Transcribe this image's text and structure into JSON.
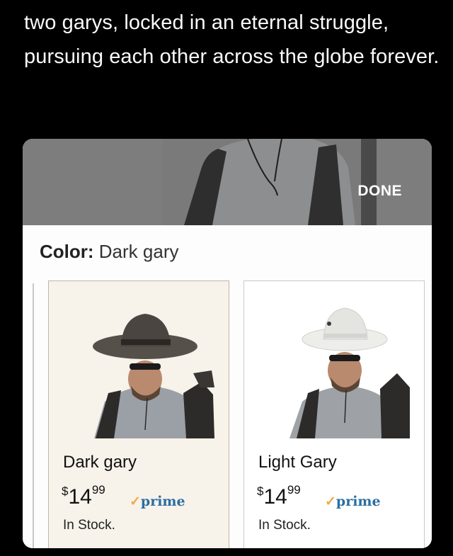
{
  "caption": "two garys, locked in an eternal struggle, pursuing each other across the globe forever.",
  "sheet": {
    "done_label": "DONE",
    "color_label": "Color:",
    "color_value": "Dark gary"
  },
  "variants": [
    {
      "name": "Dark gary",
      "price_currency": "$",
      "price_dollars": "14",
      "price_cents": "99",
      "prime_check": "✓",
      "prime_label": "prime",
      "stock": "In Stock.",
      "selected": true,
      "hat_color": "#4e4a45"
    },
    {
      "name": "Light Gary",
      "price_currency": "$",
      "price_dollars": "14",
      "price_cents": "99",
      "prime_check": "✓",
      "prime_label": "prime",
      "stock": "In Stock.",
      "selected": false,
      "hat_color": "#e9e9e6"
    }
  ],
  "colors": {
    "background": "#000000",
    "sheet": "#fdfdfd",
    "selected_tile": "#f7f2ea",
    "prime_blue": "#2a6fa1",
    "prime_check": "#f3a847"
  }
}
